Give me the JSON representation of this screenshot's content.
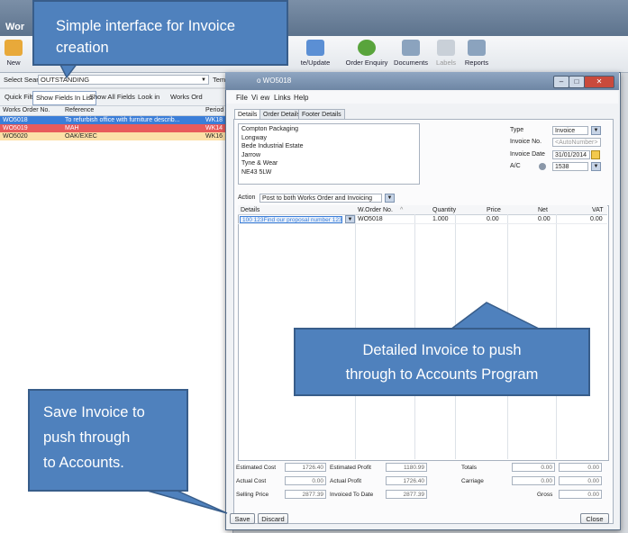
{
  "app": {
    "title": "Wor"
  },
  "ribbon": [
    {
      "label": "New",
      "icon": "new-document-icon"
    },
    {
      "label": "te/Update",
      "icon": "update-icon"
    },
    {
      "label": "Order Enquiry",
      "icon": "enquiry-icon"
    },
    {
      "label": "Documents",
      "icon": "documents-icon"
    },
    {
      "label": "Labels",
      "icon": "labels-icon"
    },
    {
      "label": "Reports",
      "icon": "reports-icon"
    }
  ],
  "search": {
    "label": "Select Search",
    "value": "OUTSTANDING",
    "extra": "Tem"
  },
  "filter_bar": {
    "quick": "Quick Filter",
    "show_fields": "Show Fields In List",
    "show_all": "Show All Fields",
    "look_in": "Look in",
    "works": "Works Ord"
  },
  "list": {
    "headers": [
      "Works Order No.",
      "Reference",
      "Period"
    ],
    "rows": [
      {
        "no": "WO5018",
        "ref": "To refurbish office with furniture describ...",
        "period": "WK18"
      },
      {
        "no": "WO5019",
        "ref": "MAH",
        "period": "WK14"
      },
      {
        "no": "WO5020",
        "ref": "OAK/EXEC",
        "period": "WK16"
      }
    ]
  },
  "dialog": {
    "title": "o WO5018",
    "menu": [
      "File",
      "Vi",
      "ew",
      "Links",
      "Help"
    ],
    "tabs": [
      "Details",
      "Order Details",
      "Footer Details"
    ],
    "address": [
      "Compton Packaging",
      "Longway",
      "Bede Industrial Estate",
      "Jarrow",
      "Tyne & Wear",
      "NE43 5LW"
    ],
    "fields": {
      "type_label": "Type",
      "type_value": "Invoice",
      "invno_label": "Invoice No.",
      "invno_value": "<AutoNumber>",
      "date_label": "Invoice Date",
      "date_value": "31/01/2014",
      "ac_label": "A/C",
      "ac_value": "1538"
    },
    "action_label": "Action",
    "action_value": "Post to both Works Order and Invoicing",
    "grid": {
      "headers": [
        "Details",
        "W.Order No.",
        "Quantity",
        "Price",
        "Net",
        "VAT"
      ],
      "row": {
        "details": "100 123Find our proposal number 123",
        "order": "WO5018",
        "qty": "1.000",
        "price": "0.00",
        "net": "0.00",
        "vat": "0.00"
      }
    },
    "totals": {
      "est_cost_label": "Estimated Cost",
      "est_cost": "1726.40",
      "est_profit_label": "Estimated Profit",
      "est_profit": "1180.99",
      "act_cost_label": "Actual Cost",
      "act_cost": "0.00",
      "act_profit_label": "Actual Profit",
      "act_profit": "1726.40",
      "sell_label": "Selling Price",
      "sell": "2877.39",
      "inv_label": "Invoiced To Date",
      "inv": "2877.39",
      "totals_label": "Totals",
      "totals_a": "0.00",
      "totals_b": "0.00",
      "carriage_label": "Carriage",
      "carriage_a": "0.00",
      "carriage_b": "0.00",
      "gross_label": "Gross",
      "gross": "0.00"
    },
    "buttons": {
      "save": "Save",
      "discard": "Discard",
      "close": "Close"
    }
  },
  "callouts": {
    "top": [
      "Simple interface for Invoice",
      "creation"
    ],
    "middle": [
      "Detailed Invoice to push",
      "through to Accounts Program"
    ],
    "left": [
      "Save Invoice to",
      "push through",
      "to Accounts."
    ]
  }
}
